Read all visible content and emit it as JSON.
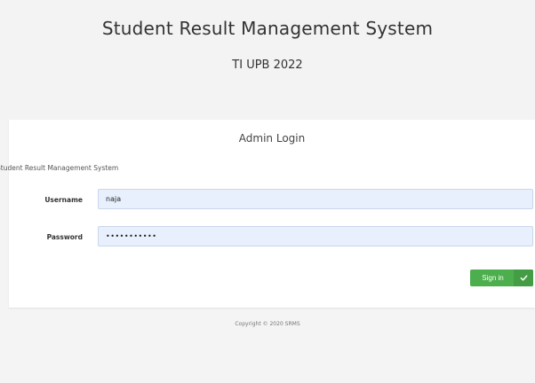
{
  "header": {
    "title": "Student Result Management System",
    "subtitle": "TI UPB 2022"
  },
  "login": {
    "title": "Admin Login",
    "caption": "Student Result Management System",
    "username_label": "Username",
    "username_value": "naja",
    "password_label": "Password",
    "password_value": "•••••••••••",
    "signin_label": "Sign in",
    "signin_icon": "check-icon"
  },
  "footer": {
    "copyright": "Copyright © 2020 SRMS"
  },
  "colors": {
    "background": "#f4f4f4",
    "card": "#ffffff",
    "input_fill": "#e8f0fe",
    "button": "#4cae4c"
  }
}
